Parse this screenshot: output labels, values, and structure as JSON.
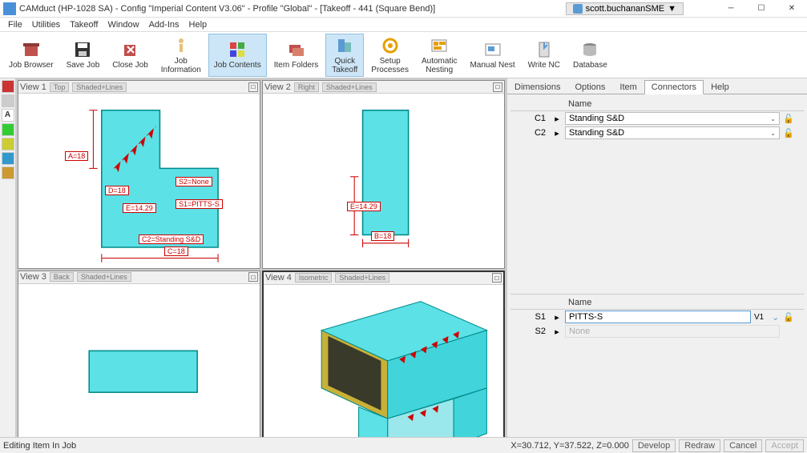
{
  "title": "CAMduct (HP-1028 SA) - Config \"Imperial Content V3.06\" - Profile \"Global\" - [Takeoff - 441 (Square Bend)]",
  "user": "scott.buchananSME",
  "menu": [
    "File",
    "Utilities",
    "Takeoff",
    "Window",
    "Add-Ins",
    "Help"
  ],
  "toolbar": [
    {
      "label": "Job Browser"
    },
    {
      "label": "Save Job"
    },
    {
      "label": "Close Job"
    },
    {
      "label": "Job\nInformation"
    },
    {
      "label": "Job Contents"
    },
    {
      "label": "Item Folders"
    },
    {
      "label": "Quick\nTakeoff"
    },
    {
      "label": "Setup\nProcesses"
    },
    {
      "label": "Automatic\nNesting"
    },
    {
      "label": "Manual Nest"
    },
    {
      "label": "Write NC"
    },
    {
      "label": "Database"
    }
  ],
  "viewports": {
    "v1": {
      "name": "View 1",
      "mode1": "Top",
      "mode2": "Shaded+Lines"
    },
    "v2": {
      "name": "View 2",
      "mode1": "Right",
      "mode2": "Shaded+Lines"
    },
    "v3": {
      "name": "View 3",
      "mode1": "Back",
      "mode2": "Shaded+Lines"
    },
    "v4": {
      "name": "View 4",
      "mode1": "Isometric",
      "mode2": "Shaded+Lines"
    }
  },
  "dims": {
    "A": "A=18",
    "D": "D=18",
    "E": "E=14.29",
    "E2": "E=14.29",
    "S1": "S1=PITTS-S",
    "S2": "S2=None",
    "C2": "C2=Standing S&D",
    "C": "C=18",
    "B": "B=18"
  },
  "rightTabs": [
    "Dimensions",
    "Options",
    "Item",
    "Connectors",
    "Help"
  ],
  "activeTab": "Connectors",
  "connHeader": "Name",
  "connectors": [
    {
      "id": "C1",
      "name": "Standing S&D"
    },
    {
      "id": "C2",
      "name": "Standing S&D"
    }
  ],
  "seamHeader": "Name",
  "seams": {
    "s1": {
      "id": "S1",
      "value": "PITTS-S",
      "suffix": "V1"
    },
    "s2": {
      "id": "S2",
      "value": "None"
    }
  },
  "status": {
    "left": "Editing Item In Job",
    "coords": "X=30.712, Y=37.522, Z=0.000",
    "buttons": [
      "Develop",
      "Redraw",
      "Cancel",
      "Accept"
    ]
  }
}
